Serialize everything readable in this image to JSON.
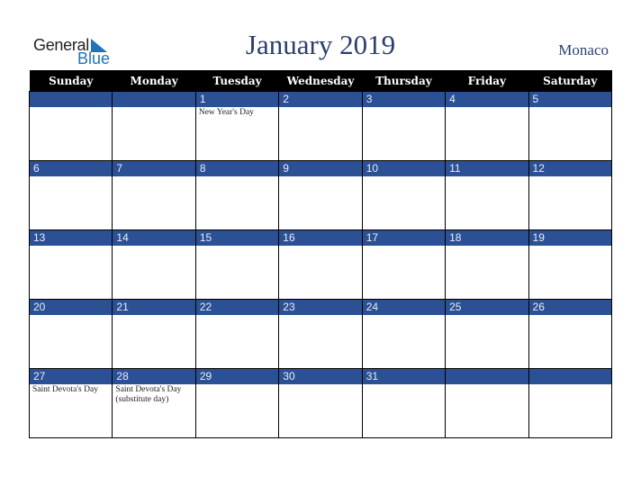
{
  "logo": {
    "word1": "General",
    "word2": "Blue"
  },
  "header": {
    "title": "January 2019",
    "country": "Monaco"
  },
  "colors": {
    "accent": "#2c5094",
    "header_bg": "#000000",
    "title": "#2b3f6b"
  },
  "weekdays": [
    "Sunday",
    "Monday",
    "Tuesday",
    "Wednesday",
    "Thursday",
    "Friday",
    "Saturday"
  ],
  "weeks": [
    [
      {
        "day": "",
        "holiday": ""
      },
      {
        "day": "",
        "holiday": ""
      },
      {
        "day": "1",
        "holiday": "New Year's Day"
      },
      {
        "day": "2",
        "holiday": ""
      },
      {
        "day": "3",
        "holiday": ""
      },
      {
        "day": "4",
        "holiday": ""
      },
      {
        "day": "5",
        "holiday": ""
      }
    ],
    [
      {
        "day": "6",
        "holiday": ""
      },
      {
        "day": "7",
        "holiday": ""
      },
      {
        "day": "8",
        "holiday": ""
      },
      {
        "day": "9",
        "holiday": ""
      },
      {
        "day": "10",
        "holiday": ""
      },
      {
        "day": "11",
        "holiday": ""
      },
      {
        "day": "12",
        "holiday": ""
      }
    ],
    [
      {
        "day": "13",
        "holiday": ""
      },
      {
        "day": "14",
        "holiday": ""
      },
      {
        "day": "15",
        "holiday": ""
      },
      {
        "day": "16",
        "holiday": ""
      },
      {
        "day": "17",
        "holiday": ""
      },
      {
        "day": "18",
        "holiday": ""
      },
      {
        "day": "19",
        "holiday": ""
      }
    ],
    [
      {
        "day": "20",
        "holiday": ""
      },
      {
        "day": "21",
        "holiday": ""
      },
      {
        "day": "22",
        "holiday": ""
      },
      {
        "day": "23",
        "holiday": ""
      },
      {
        "day": "24",
        "holiday": ""
      },
      {
        "day": "25",
        "holiday": ""
      },
      {
        "day": "26",
        "holiday": ""
      }
    ],
    [
      {
        "day": "27",
        "holiday": "Saint Devota's Day"
      },
      {
        "day": "28",
        "holiday": "Saint Devota's Day (substitute day)"
      },
      {
        "day": "29",
        "holiday": ""
      },
      {
        "day": "30",
        "holiday": ""
      },
      {
        "day": "31",
        "holiday": ""
      },
      {
        "day": "",
        "holiday": ""
      },
      {
        "day": "",
        "holiday": ""
      }
    ]
  ]
}
